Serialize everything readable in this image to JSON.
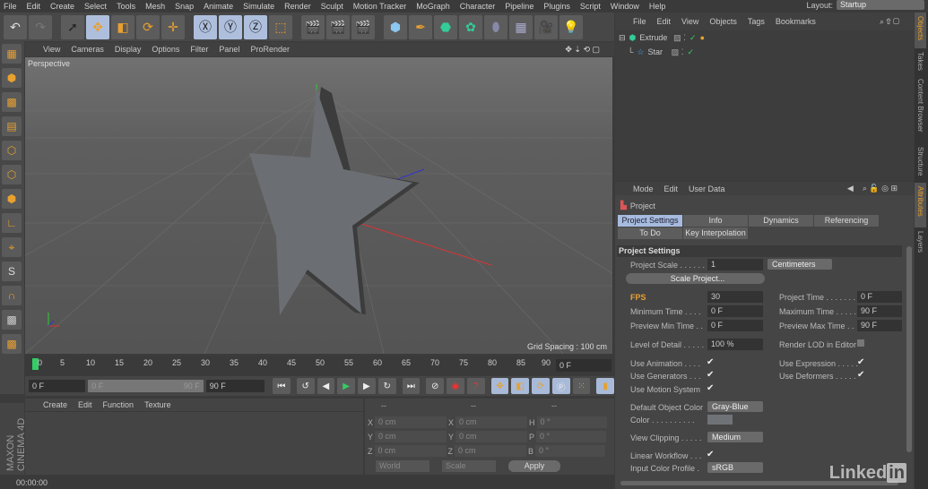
{
  "menu": [
    "File",
    "Edit",
    "Create",
    "Select",
    "Tools",
    "Mesh",
    "Snap",
    "Animate",
    "Simulate",
    "Render",
    "Sculpt",
    "Motion Tracker",
    "MoGraph",
    "Character",
    "Pipeline",
    "Plugins",
    "Script",
    "Window",
    "Help"
  ],
  "layout": {
    "label": "Layout:",
    "value": "Startup"
  },
  "viewport": {
    "menu": [
      "View",
      "Cameras",
      "Display",
      "Options",
      "Filter",
      "Panel",
      "ProRender"
    ],
    "label": "Perspective",
    "grid_spacing": "Grid Spacing : 100 cm"
  },
  "timeline": {
    "ticks": [
      "0",
      "5",
      "10",
      "15",
      "20",
      "25",
      "30",
      "35",
      "40",
      "45",
      "50",
      "55",
      "60",
      "65",
      "70",
      "75",
      "80",
      "85",
      "90"
    ],
    "current": "0 F",
    "start": "0 F",
    "range_start": "0 F",
    "range_end": "90 F",
    "end": "90 F"
  },
  "material": {
    "menu": [
      "Create",
      "Edit",
      "Function",
      "Texture"
    ],
    "logo": "MAXON CINEMA 4D"
  },
  "coords": {
    "headers": [
      "--",
      "--",
      "--"
    ],
    "rows": [
      [
        "X",
        "0 cm",
        "X",
        "0 cm",
        "H",
        "0 °"
      ],
      [
        "Y",
        "0 cm",
        "Y",
        "0 cm",
        "P",
        "0 °"
      ],
      [
        "Z",
        "0 cm",
        "Z",
        "0 cm",
        "B",
        "0 °"
      ]
    ],
    "world": "World",
    "scale": "Scale",
    "apply": "Apply"
  },
  "status": "00:00:00",
  "objects": {
    "menu": [
      "File",
      "Edit",
      "View",
      "Objects",
      "Tags",
      "Bookmarks"
    ],
    "items": [
      "Extrude",
      "Star"
    ]
  },
  "attributes": {
    "menu": [
      "Mode",
      "Edit",
      "User Data"
    ],
    "title": "Project",
    "tabs": [
      "Project Settings",
      "Info",
      "Dynamics",
      "Referencing",
      "To Do",
      "Key Interpolation"
    ],
    "section": "Project Settings",
    "project_scale": {
      "label": "Project Scale . . . . . .",
      "value": "1",
      "unit": "Centimeters"
    },
    "scale_button": "Scale Project...",
    "fps": {
      "label": "FPS",
      "value": "30"
    },
    "min_time": {
      "label": "Minimum Time . . . .",
      "value": "0 F"
    },
    "preview_min": {
      "label": "Preview Min Time . .",
      "value": "0 F"
    },
    "project_time": {
      "label": "Project Time . . . . . . .",
      "value": "0 F"
    },
    "max_time": {
      "label": "Maximum Time . . . . .",
      "value": "90 F"
    },
    "preview_max": {
      "label": "Preview Max Time . .",
      "value": "90 F"
    },
    "lod": {
      "label": "Level of Detail . . . . .",
      "value": "100 %"
    },
    "render_lod": "Render LOD in Editor",
    "use_animation": "Use Animation . . . .",
    "use_generators": "Use Generators . . .",
    "use_motion": "Use Motion System",
    "use_expression": "Use Expression . . . . .",
    "use_deformers": "Use Deformers . . . . .",
    "default_color": {
      "label": "Default Object Color",
      "value": "Gray-Blue"
    },
    "color_label": "Color . . . . . . . . . .",
    "view_clipping": {
      "label": "View Clipping . . . . .",
      "value": "Medium"
    },
    "linear_workflow": "Linear Workflow . . .",
    "input_profile": {
      "label": "Input Color Profile .",
      "value": "sRGB"
    }
  },
  "side_tabs": [
    "Objects",
    "Takes",
    "Content Browser",
    "Structure",
    "Attributes",
    "Layers"
  ],
  "watermark": {
    "text": "Linked",
    "box": "in"
  }
}
